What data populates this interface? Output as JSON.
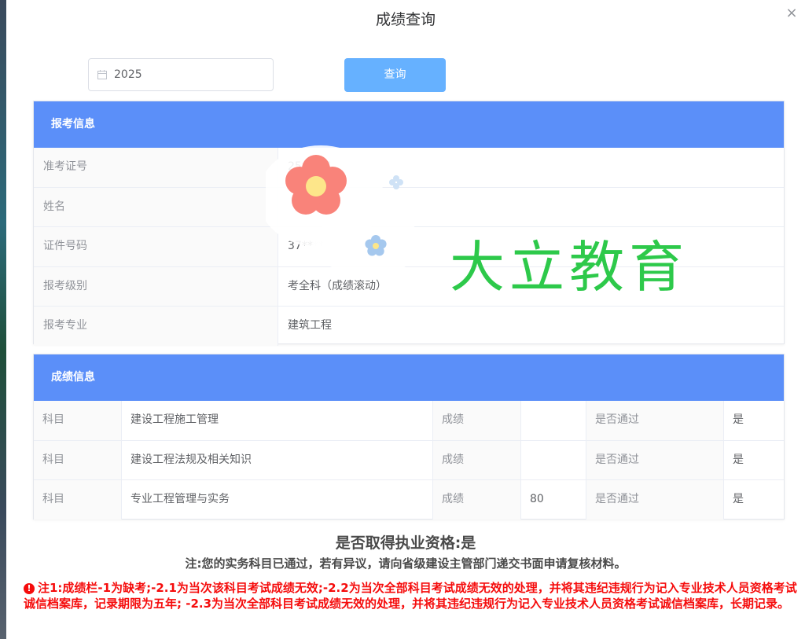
{
  "dialog": {
    "title": "成绩查询"
  },
  "query": {
    "year_value": "2025",
    "button_label": "查询"
  },
  "enroll": {
    "header": "报考信息",
    "rows": [
      {
        "label": "准考证号",
        "value": "25****7"
      },
      {
        "label": "姓名",
        "value": ""
      },
      {
        "label": "证件号码",
        "value": "37****"
      },
      {
        "label": "报考级别",
        "value": "考全科（成绩滚动）"
      },
      {
        "label": "报考专业",
        "value": "建筑工程"
      }
    ]
  },
  "scores": {
    "header": "成绩信息",
    "rows": [
      {
        "subject_label": "科目",
        "subject": "建设工程施工管理",
        "score_label": "成绩",
        "score": "",
        "pass_label": "是否通过",
        "pass": "是"
      },
      {
        "subject_label": "科目",
        "subject": "建设工程法规及相关知识",
        "score_label": "成绩",
        "score": "",
        "pass_label": "是否通过",
        "pass": "是"
      },
      {
        "subject_label": "科目",
        "subject": "专业工程管理与实务",
        "score_label": "成绩",
        "score": "80",
        "pass_label": "是否通过",
        "pass": "是"
      }
    ]
  },
  "result": {
    "qualification": "是否取得执业资格:是",
    "note": "注:您的实务科目已通过，若有异议，请向省级建设主管部门递交书面申请复核材料。",
    "warning": "注1:成绩栏-1为缺考;-2.1为当次该科目考试成绩无效;-2.2为当次全部科目考试成绩无效的处理，并将其违纪违规行为记入专业技术人员资格考试诚信档案库，记录期限为五年; -2.3为当次全部科目考试成绩无效的处理，并将其违纪违规行为记入专业技术人员资格考试诚信档案库，长期记录。",
    "warning_icon_glyph": "!"
  },
  "watermark": {
    "text": "大立教育"
  },
  "colors": {
    "header_blue": "#5b8ff9",
    "button_blue": "#66b1ff",
    "warning_red": "#f50c0c",
    "watermark_green": "#2dc94a"
  }
}
